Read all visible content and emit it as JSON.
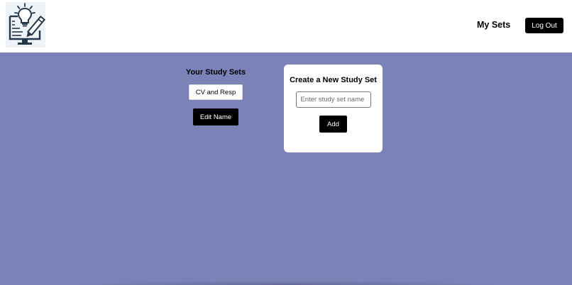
{
  "header": {
    "logo_icon": "lightbulb-document-pencil-icon",
    "nav_my_sets": "My Sets",
    "logout_label": "Log Out"
  },
  "study_sets": {
    "heading": "Your Study Sets",
    "items": [
      {
        "label": "CV and Resp"
      }
    ],
    "edit_label": "Edit Name"
  },
  "create_card": {
    "title": "Create a New Study Set",
    "input_value": "",
    "input_placeholder": "Enter study set name",
    "add_label": "Add"
  },
  "colors": {
    "page_background": "#7a82b8",
    "header_background": "#ffffff",
    "button_background": "#000000",
    "button_text": "#ffffff"
  }
}
